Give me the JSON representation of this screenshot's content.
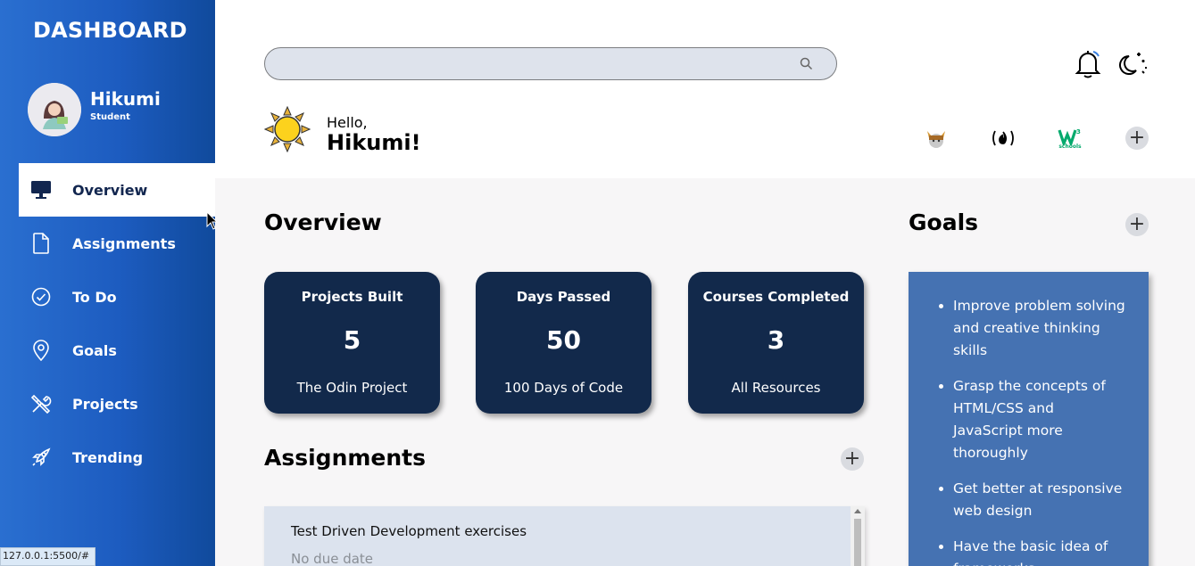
{
  "sidebar": {
    "brand": "DASHBOARD",
    "user": {
      "name": "Hikumi",
      "role": "Student"
    },
    "items": [
      {
        "label": "Overview",
        "icon": "monitor-icon",
        "active": true
      },
      {
        "label": "Assignments",
        "icon": "document-icon"
      },
      {
        "label": "To Do",
        "icon": "check-circle-icon"
      },
      {
        "label": "Goals",
        "icon": "map-pin-icon"
      },
      {
        "label": "Projects",
        "icon": "tools-icon"
      },
      {
        "label": "Trending",
        "icon": "rocket-icon"
      }
    ]
  },
  "header": {
    "search": {
      "value": "",
      "placeholder": ""
    },
    "greeting": "Hello,",
    "greeting_name": "Hikumi!",
    "resources": [
      {
        "icon": "odin-project-icon"
      },
      {
        "icon": "freecodecamp-icon"
      },
      {
        "icon": "w3schools-icon",
        "text": "schools"
      }
    ]
  },
  "overview": {
    "title": "Overview",
    "cards": [
      {
        "title": "Projects Built",
        "value": "5",
        "subtitle": "The Odin Project"
      },
      {
        "title": "Days Passed",
        "value": "50",
        "subtitle": "100 Days of Code"
      },
      {
        "title": "Courses Completed",
        "value": "3",
        "subtitle": "All Resources"
      }
    ]
  },
  "assignments": {
    "title": "Assignments",
    "items": [
      {
        "title": "Test Driven Development exercises",
        "due": "No due date"
      }
    ]
  },
  "goals": {
    "title": "Goals",
    "items": [
      "Improve problem solving and creative thinking skills",
      "Grasp the concepts of HTML/CSS and JavaScript more thoroughly",
      "Get better at responsive web design",
      "Have the basic idea of frameworks"
    ]
  },
  "status_bar": {
    "url": "127.0.0.1:5500/#"
  },
  "colors": {
    "sidebar_start": "#2a6fd0",
    "sidebar_end": "#104a9c",
    "card_bg": "#12294b",
    "goals_bg": "#4572b2",
    "main_bg": "#f7f6f7"
  }
}
